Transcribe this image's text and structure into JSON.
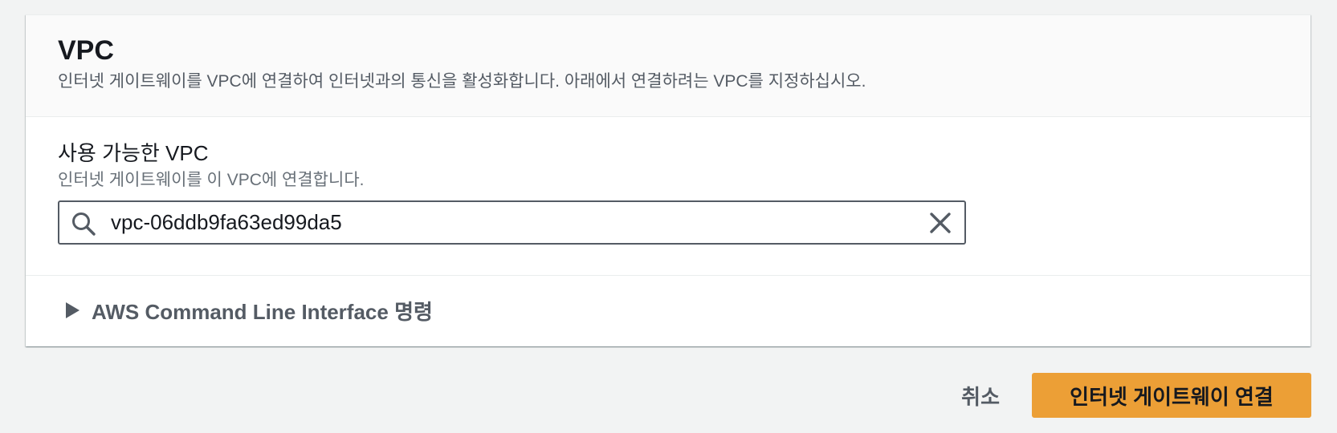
{
  "panel": {
    "title": "VPC",
    "description": "인터넷 게이트웨이를 VPC에 연결하여 인터넷과의 통신을 활성화합니다. 아래에서 연결하려는 VPC를 지정하십시오."
  },
  "field": {
    "label": "사용 가능한 VPC",
    "description": "인터넷 게이트웨이를 이 VPC에 연결합니다.",
    "value": "vpc-06ddb9fa63ed99da5",
    "icon": "search-icon",
    "clear_icon": "close-icon"
  },
  "cli": {
    "label": "AWS Command Line Interface 명령",
    "icon": "caret-right-icon"
  },
  "footer": {
    "cancel_label": "취소",
    "primary_label": "인터넷 게이트웨이 연결"
  },
  "colors": {
    "primary": "#ec9f36",
    "background": "#f2f3f3",
    "text": "#16191f",
    "muted": "#545b64"
  }
}
